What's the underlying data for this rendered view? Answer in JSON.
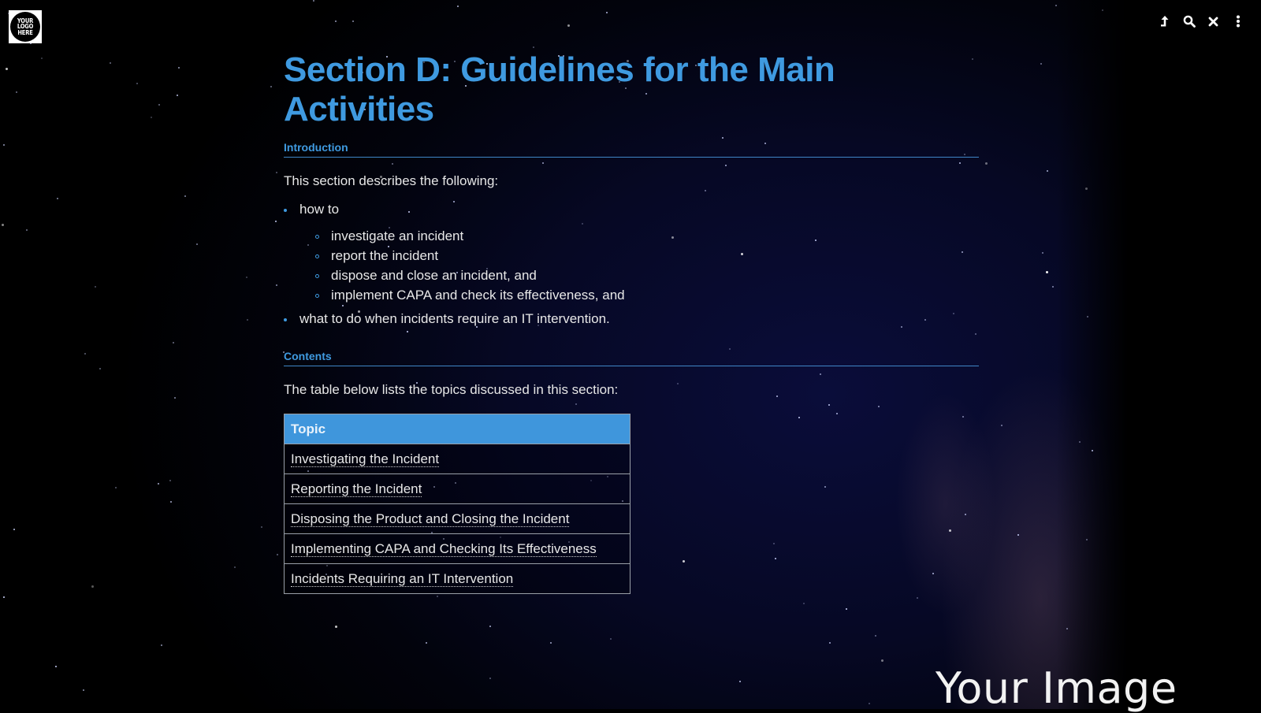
{
  "logo": {
    "lines": [
      "YOUR",
      "LOGO",
      "HERE"
    ]
  },
  "toolbar": {
    "buttons": [
      {
        "name": "up-icon"
      },
      {
        "name": "search-icon"
      },
      {
        "name": "close-icon"
      },
      {
        "name": "more-vertical-icon"
      }
    ]
  },
  "page": {
    "title": "Section D: Guidelines for the Main Activities",
    "introduction": {
      "heading": "Introduction",
      "lead": "This section describes the following:",
      "items": [
        {
          "text": "how to",
          "subitems": [
            "investigate an incident",
            "report the incident",
            "dispose and close an incident, and",
            "implement CAPA and check its effectiveness, and"
          ]
        },
        {
          "text": "what to do when incidents require an IT intervention."
        }
      ]
    },
    "contents": {
      "heading": "Contents",
      "lead": "The table below lists the topics discussed in this section:",
      "table": {
        "header": "Topic",
        "rows": [
          "Investigating the Incident",
          "Reporting the Incident",
          "Disposing the Product and Closing the Incident",
          "Implementing CAPA and Checking Its Effectiveness",
          "Incidents Requiring an IT Intervention"
        ]
      }
    }
  },
  "background": {
    "caption": "Your Image"
  },
  "colors": {
    "accent": "#3f9ae0",
    "table_header": "#3f96dc"
  }
}
